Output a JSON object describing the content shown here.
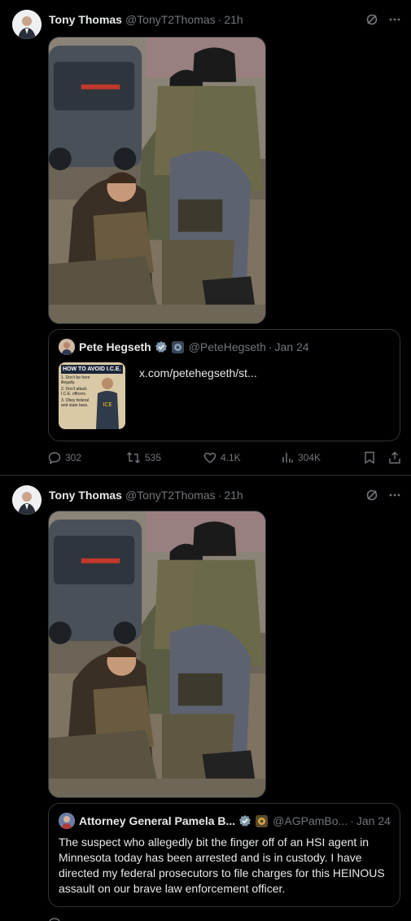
{
  "posts": [
    {
      "author": {
        "name": "Tony Thomas",
        "handle": "@TonyT2Thomas",
        "time": "21h"
      },
      "quote": {
        "author_name": "Pete Hegseth",
        "author_handle": "@PeteHegseth",
        "date": "Jan 24",
        "link_text": "x.com/petehegseth/st...",
        "thumb_title": "HOW TO AVOID I.C.E.",
        "thumb_items": [
          "1. Don't be here illegally.",
          "2. Don't attack I.C.E. officers.",
          "3. Obey federal and state laws."
        ],
        "thumb_badge": "ICE"
      },
      "stats": {
        "replies": "302",
        "reposts": "535",
        "likes": "4.1K",
        "views": "304K"
      }
    },
    {
      "author": {
        "name": "Tony Thomas",
        "handle": "@TonyT2Thomas",
        "time": "21h"
      },
      "quote": {
        "author_name": "Attorney General Pamela B...",
        "author_handle": "@AGPamBo...",
        "date": "Jan 24",
        "text": "The suspect who allegedly bit the finger off of an HSI agent in Minnesota today has been arrested and is in custody. I have directed my federal prosecutors to file charges for this HEINOUS assault on our brave law enforcement officer."
      }
    }
  ],
  "separator": "·",
  "colors": {
    "background": "#000000",
    "border": "#2f3336",
    "muted": "#71767b",
    "text": "#e7e9ea",
    "verified": "#829aab"
  },
  "icons": [
    "grok-icon",
    "more-icon",
    "verified-badge-icon",
    "reply-icon",
    "repost-icon",
    "like-icon",
    "views-icon",
    "bookmark-icon",
    "share-icon"
  ]
}
